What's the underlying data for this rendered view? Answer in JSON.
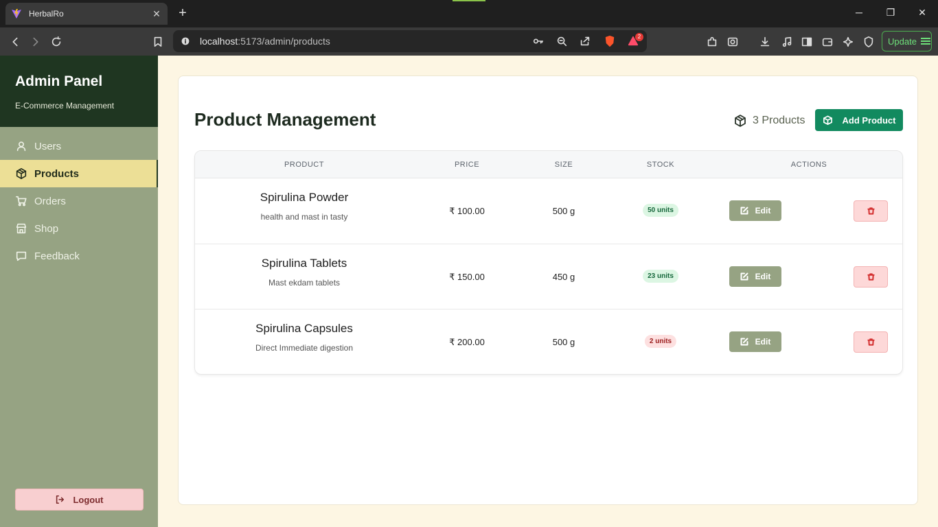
{
  "browser": {
    "tab_title": "HerbalRo",
    "url_host": "localhost",
    "url_rest": ":5173/admin/products",
    "shield_badge": "2",
    "update_label": "Update",
    "accent_color": "#6ee07a"
  },
  "sidebar": {
    "title": "Admin Panel",
    "subtitle": "E-Commerce Management",
    "items": [
      {
        "label": "Users",
        "icon": "user-icon",
        "active": false
      },
      {
        "label": "Products",
        "icon": "box-icon",
        "active": true
      },
      {
        "label": "Orders",
        "icon": "cart-icon",
        "active": false
      },
      {
        "label": "Shop",
        "icon": "store-icon",
        "active": false
      },
      {
        "label": "Feedback",
        "icon": "message-icon",
        "active": false
      }
    ],
    "logout_label": "Logout",
    "colors": {
      "header": "#1f3621",
      "body": "#96a383",
      "active": "#ecdf96"
    }
  },
  "main": {
    "title": "Product Management",
    "count_label": "3 Products",
    "add_button_label": "Add Product",
    "table": {
      "columns": [
        "PRODUCT",
        "PRICE",
        "SIZE",
        "STOCK",
        "ACTIONS"
      ],
      "edit_label": "Edit",
      "rows": [
        {
          "name": "Spirulina Powder",
          "description": "health and mast in tasty",
          "price": "₹ 100.00",
          "size": "500 g",
          "stock": "50 units",
          "stock_status": "ok"
        },
        {
          "name": "Spirulina Tablets",
          "description": "Mast ekdam tablets",
          "price": "₹ 150.00",
          "size": "450 g",
          "stock": "23 units",
          "stock_status": "ok"
        },
        {
          "name": "Spirulina Capsules",
          "description": "Direct Immediate digestion",
          "price": "₹ 200.00",
          "size": "500 g",
          "stock": "2 units",
          "stock_status": "low"
        }
      ]
    },
    "colors": {
      "add_button": "#128a5f",
      "edit_button": "#96a383",
      "delete_button": "#fdd8d8"
    }
  }
}
